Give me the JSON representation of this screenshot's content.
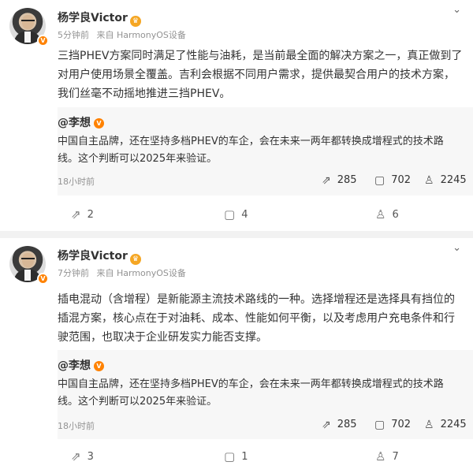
{
  "posts": [
    {
      "author": "杨学良Victor",
      "time": "5分钟前",
      "source": "来自 HarmonyOS设备",
      "text": "三挡PHEV方案同时满足了性能与油耗，是当前最全面的解决方案之一，真正做到了对用户使用场景全覆盖。吉利会根据不同用户需求，提供最契合用户的技术方案，我们丝毫不动摇地推进三挡PHEV。",
      "quote": {
        "author": "@李想",
        "text": "中国自主品牌，还在坚持多档PHEV的车企，会在未来一两年都转换成增程式的技术路线。这个判断可以2025年来验证。",
        "time": "18小时前",
        "reposts": "285",
        "comments": "702",
        "likes": "2245"
      },
      "reposts": "2",
      "comments": "4",
      "likes": "6"
    },
    {
      "author": "杨学良Victor",
      "time": "7分钟前",
      "source": "来自 HarmonyOS设备",
      "text": "插电混动（含增程）是新能源主流技术路线的一种。选择增程还是选择具有挡位的插混方案，核心点在于对油耗、成本、性能如何平衡，以及考虑用户充电条件和行驶范围，也取决于企业研发实力能否支撑。",
      "quote": {
        "author": "@李想",
        "text": "中国自主品牌，还在坚持多档PHEV的车企，会在未来一两年都转换成增程式的技术路线。这个判断可以2025年来验证。",
        "time": "18小时前",
        "reposts": "285",
        "comments": "702",
        "likes": "2245"
      },
      "reposts": "3",
      "comments": "1",
      "likes": "7"
    }
  ],
  "icons": {
    "repost": "repost-icon",
    "comment": "comment-icon",
    "like": "like-icon",
    "more": "chevron-down-icon",
    "verified": "verified-badge-icon",
    "crown": "crown-icon"
  },
  "colors": {
    "verified": "#ff8200",
    "crown": "#f5a623",
    "meta": "#939393",
    "quote_bg": "#f7f7f7"
  }
}
